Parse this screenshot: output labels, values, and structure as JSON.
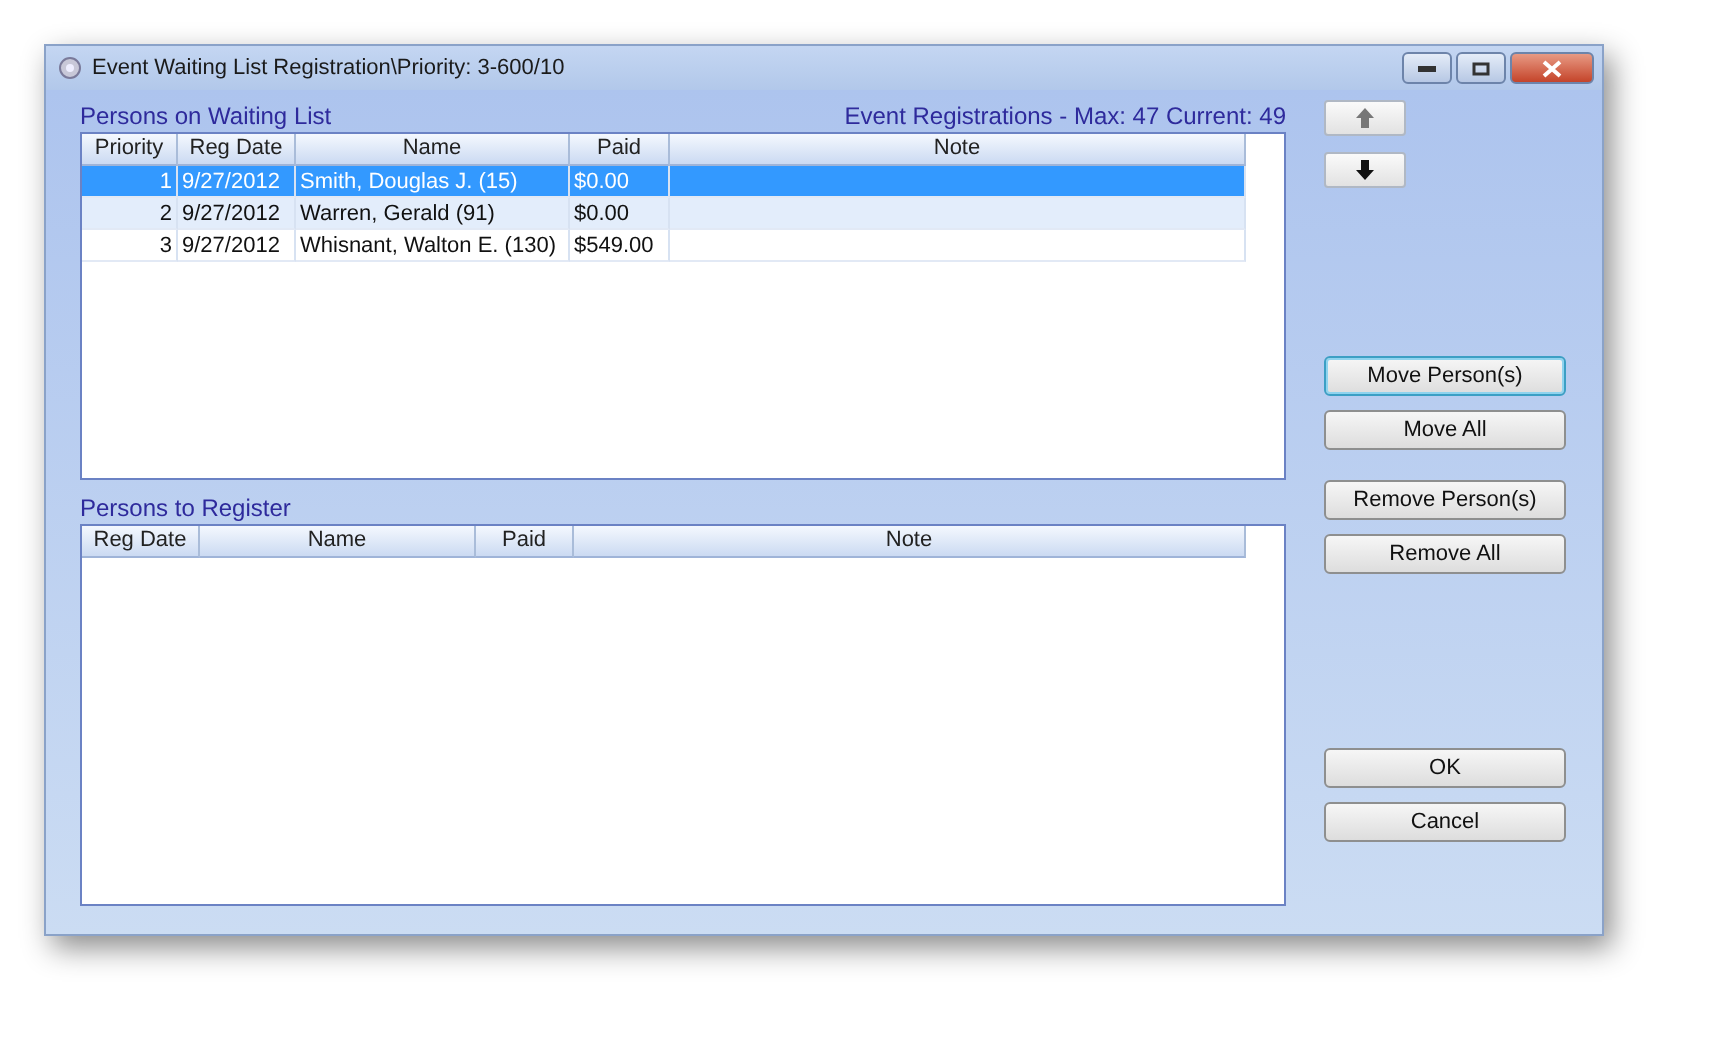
{
  "window": {
    "title": "Event Waiting List Registration\\Priority: 3-600/10"
  },
  "waiting_list": {
    "title": "Persons on Waiting List",
    "summary": "Event Registrations - Max: 47 Current: 49",
    "columns": [
      "Priority",
      "Reg Date",
      "Name",
      "Paid",
      "Note"
    ],
    "rows": [
      {
        "cells": [
          "1",
          "9/27/2012",
          "Smith, Douglas J. (15)",
          "$0.00",
          ""
        ],
        "selected": true
      },
      {
        "cells": [
          "2",
          "9/27/2012",
          "Warren, Gerald (91)",
          "$0.00",
          ""
        ],
        "selected": false
      },
      {
        "cells": [
          "3",
          "9/27/2012",
          "Whisnant, Walton E. (130)",
          "$549.00",
          ""
        ],
        "selected": false
      }
    ]
  },
  "to_register": {
    "title": "Persons to Register",
    "columns": [
      "Reg Date",
      "Name",
      "Paid",
      "Note"
    ]
  },
  "buttons": [
    {
      "label": "Move Person(s)",
      "focused": true
    },
    {
      "label": "Move All",
      "focused": false
    },
    {
      "label": "Remove Person(s)",
      "focused": false
    },
    {
      "label": "Remove All",
      "focused": false
    },
    {
      "label": "OK",
      "focused": false
    },
    {
      "label": "Cancel",
      "focused": false
    }
  ]
}
